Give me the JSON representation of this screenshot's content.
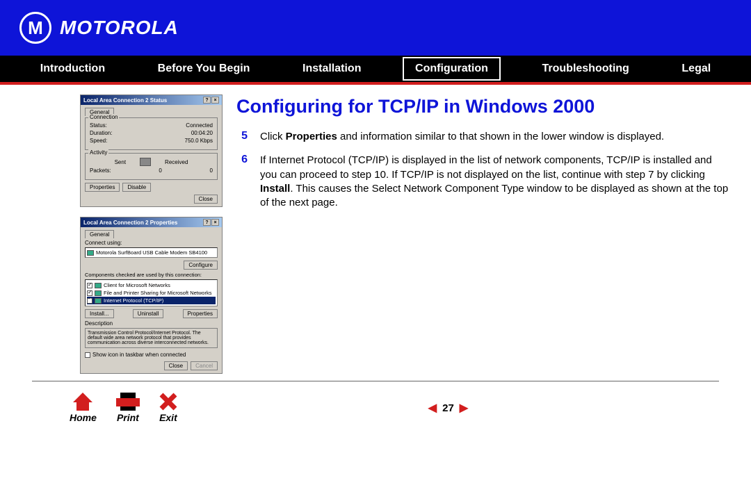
{
  "brand": "MOTOROLA",
  "nav": {
    "items": [
      "Introduction",
      "Before You Begin",
      "Installation",
      "Configuration",
      "Troubleshooting",
      "Legal"
    ],
    "active_index": 3
  },
  "page": {
    "title": "Configuring for TCP/IP in Windows 2000",
    "steps": [
      {
        "num": "5",
        "pre": "Click ",
        "bold": "Properties",
        "post": " and information similar to that shown in the lower window is displayed."
      },
      {
        "num": "6",
        "pre": "If Internet Protocol (TCP/IP) is displayed in the list of network components, TCP/IP is installed and you can proceed to step 10. If TCP/IP is not displayed on the list, continue with step 7 by clicking ",
        "bold": "Install",
        "post": ". This causes the Select Network Component Type window to be displayed as shown at the top of the next page."
      }
    ]
  },
  "status_dialog": {
    "title": "Local Area Connection 2 Status",
    "tab": "General",
    "connection_group": "Connection",
    "status_label": "Status:",
    "status_value": "Connected",
    "duration_label": "Duration:",
    "duration_value": "00:04:20",
    "speed_label": "Speed:",
    "speed_value": "750.0 Kbps",
    "activity_group": "Activity",
    "sent_label": "Sent",
    "received_label": "Received",
    "packets_label": "Packets:",
    "packets_sent": "0",
    "packets_received": "0",
    "btn_properties": "Properties",
    "btn_disable": "Disable",
    "btn_close": "Close"
  },
  "props_dialog": {
    "title": "Local Area Connection 2 Properties",
    "tab": "General",
    "connect_using": "Connect using:",
    "adapter": "Motorola SurfBoard USB Cable Modem SB4100",
    "btn_configure": "Configure",
    "components_label": "Components checked are used by this connection:",
    "items": [
      "Client for Microsoft Networks",
      "File and Printer Sharing for Microsoft Networks",
      "Internet Protocol (TCP/IP)"
    ],
    "selected_index": 2,
    "btn_install": "Install...",
    "btn_uninstall": "Uninstall",
    "btn_properties": "Properties",
    "desc_label": "Description",
    "desc_text": "Transmission Control Protocol/Internet Protocol. The default wide area network protocol that provides communication across diverse interconnected networks.",
    "show_icon": "Show icon in taskbar when connected",
    "btn_close": "Close",
    "btn_cancel": "Cancel"
  },
  "footer": {
    "home": "Home",
    "print": "Print",
    "exit": "Exit",
    "page": "27"
  }
}
